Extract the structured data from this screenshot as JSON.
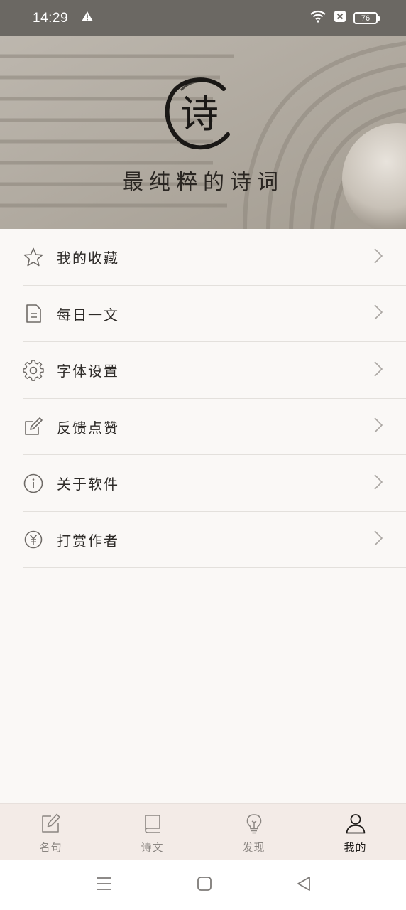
{
  "status": {
    "time": "14:29",
    "battery": "76"
  },
  "banner": {
    "logo_char": "诗",
    "slogan": "最纯粹的诗词"
  },
  "menu": {
    "items": [
      {
        "label": "我的收藏",
        "icon": "star-icon"
      },
      {
        "label": "每日一文",
        "icon": "document-icon"
      },
      {
        "label": "字体设置",
        "icon": "gear-icon"
      },
      {
        "label": "反馈点赞",
        "icon": "edit-icon"
      },
      {
        "label": "关于软件",
        "icon": "info-icon"
      },
      {
        "label": "打赏作者",
        "icon": "yen-icon"
      }
    ]
  },
  "tabs": [
    {
      "label": "名句",
      "icon": "pencil-square-icon",
      "active": false
    },
    {
      "label": "诗文",
      "icon": "book-icon",
      "active": false
    },
    {
      "label": "发现",
      "icon": "lightbulb-icon",
      "active": false
    },
    {
      "label": "我的",
      "icon": "user-icon",
      "active": true
    }
  ],
  "colors": {
    "menu_bg": "#faf8f6",
    "tabbar_bg": "#f3ebe7",
    "active_tab": "#1f1c1a",
    "inactive_tab": "#8b8682"
  }
}
